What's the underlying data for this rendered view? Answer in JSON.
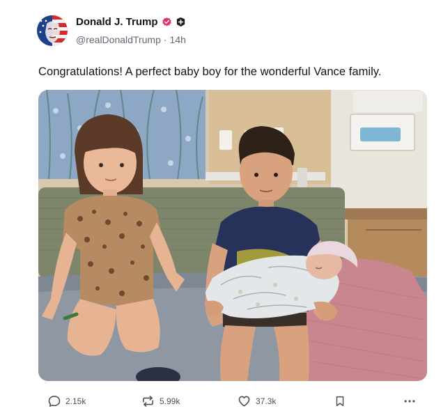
{
  "author": {
    "display_name": "Donald J. Trump",
    "handle": "@realDonaldTrump",
    "separator": "·",
    "time": "14h"
  },
  "post": {
    "text": "Congratulations! A perfect baby boy for the wonderful Vance family."
  },
  "stats": {
    "replies": "2.15k",
    "reposts": "5.99k",
    "likes": "37.3k"
  },
  "icons": {
    "reply": "speech-bubble-icon",
    "repost": "repost-arrows-icon",
    "like": "heart-icon",
    "bookmark": "bookmark-icon",
    "more": "more-dots-icon",
    "verified": "verified-badge-icon",
    "plus": "plus-badge-icon"
  },
  "colors": {
    "verified": "#e0316e",
    "text": "#141414",
    "muted": "#606770"
  }
}
